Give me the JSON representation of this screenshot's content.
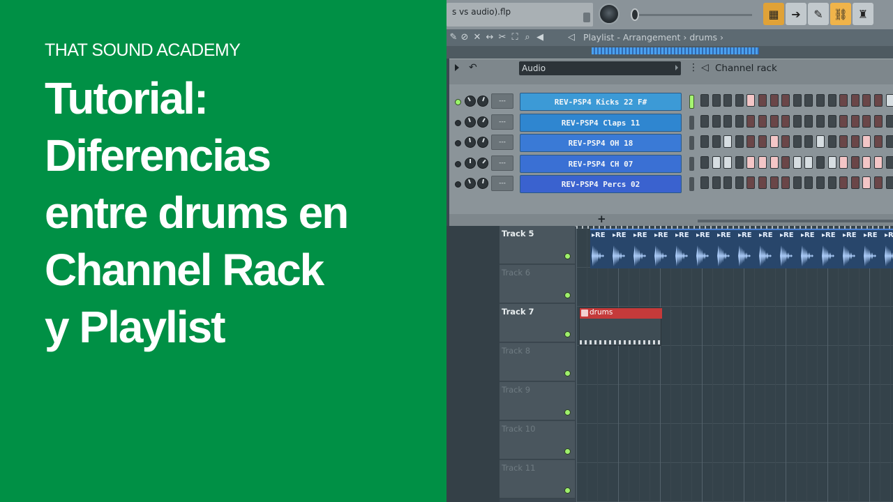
{
  "thumbnail": {
    "brand": "THAT SOUND ACADEMY",
    "title_lines": [
      "Tutorial:",
      "Diferencias",
      "entre drums en",
      "Channel Rack",
      "y Playlist"
    ]
  },
  "flstudio": {
    "filename": "s vs audio).flp",
    "breadcrumb": "Playlist - Arrangement › drums ›",
    "channel_rack": {
      "filter_label": "Audio",
      "title": "Channel rack",
      "channels": [
        {
          "name": "REV-PSP4 Kicks 22 F#",
          "mixer": "---",
          "selected": true,
          "color": "#3c9ad6",
          "steps": [
            0,
            0,
            0,
            0,
            1,
            0,
            0,
            0,
            0,
            0,
            0,
            0,
            0,
            0,
            0,
            0,
            1,
            0,
            0,
            0,
            0,
            0,
            0,
            0
          ]
        },
        {
          "name": "REV-PSP4 Claps 11",
          "mixer": "---",
          "selected": false,
          "color": "#2f86d0",
          "steps": [
            0,
            0,
            0,
            0,
            0,
            0,
            0,
            0,
            0,
            0,
            0,
            0,
            0,
            0,
            0,
            0,
            0,
            0,
            0,
            0,
            0,
            0,
            0,
            0
          ]
        },
        {
          "name": "REV-PSP4 OH 18",
          "mixer": "---",
          "selected": false,
          "color": "#3a7ad6",
          "steps": [
            0,
            0,
            1,
            0,
            0,
            0,
            1,
            0,
            0,
            0,
            1,
            0,
            0,
            0,
            1,
            0,
            0,
            0,
            1,
            0,
            0,
            0,
            1,
            0
          ]
        },
        {
          "name": "REV-PSP4 CH 07",
          "mixer": "---",
          "selected": false,
          "color": "#3a70d4",
          "steps": [
            0,
            1,
            1,
            0,
            1,
            1,
            1,
            0,
            1,
            1,
            0,
            1,
            1,
            0,
            1,
            1,
            0,
            1,
            1,
            1,
            0,
            1,
            1,
            1
          ]
        },
        {
          "name": "REV-PSP4 Percs 02",
          "mixer": "---",
          "selected": false,
          "color": "#3a62cf",
          "steps": [
            0,
            0,
            0,
            0,
            0,
            0,
            0,
            0,
            0,
            0,
            0,
            0,
            0,
            0,
            1,
            0,
            0,
            0,
            1,
            1,
            0,
            0,
            0,
            0
          ]
        }
      ],
      "add_label": "+"
    },
    "playlist": {
      "tracks": [
        {
          "name": "Track 5",
          "active": true
        },
        {
          "name": "Track 6",
          "active": false
        },
        {
          "name": "Track 7",
          "active": true
        },
        {
          "name": "Track 8",
          "active": false
        },
        {
          "name": "Track 9",
          "active": false
        },
        {
          "name": "Track 10",
          "active": false
        },
        {
          "name": "Track 11",
          "active": false
        }
      ],
      "audio_clip_label": "RE",
      "pattern_clip_label": "drums"
    }
  },
  "colors": {
    "brand_green": "#009045",
    "pattern_red": "#c53a3a",
    "audio_blue": "#28466b"
  }
}
